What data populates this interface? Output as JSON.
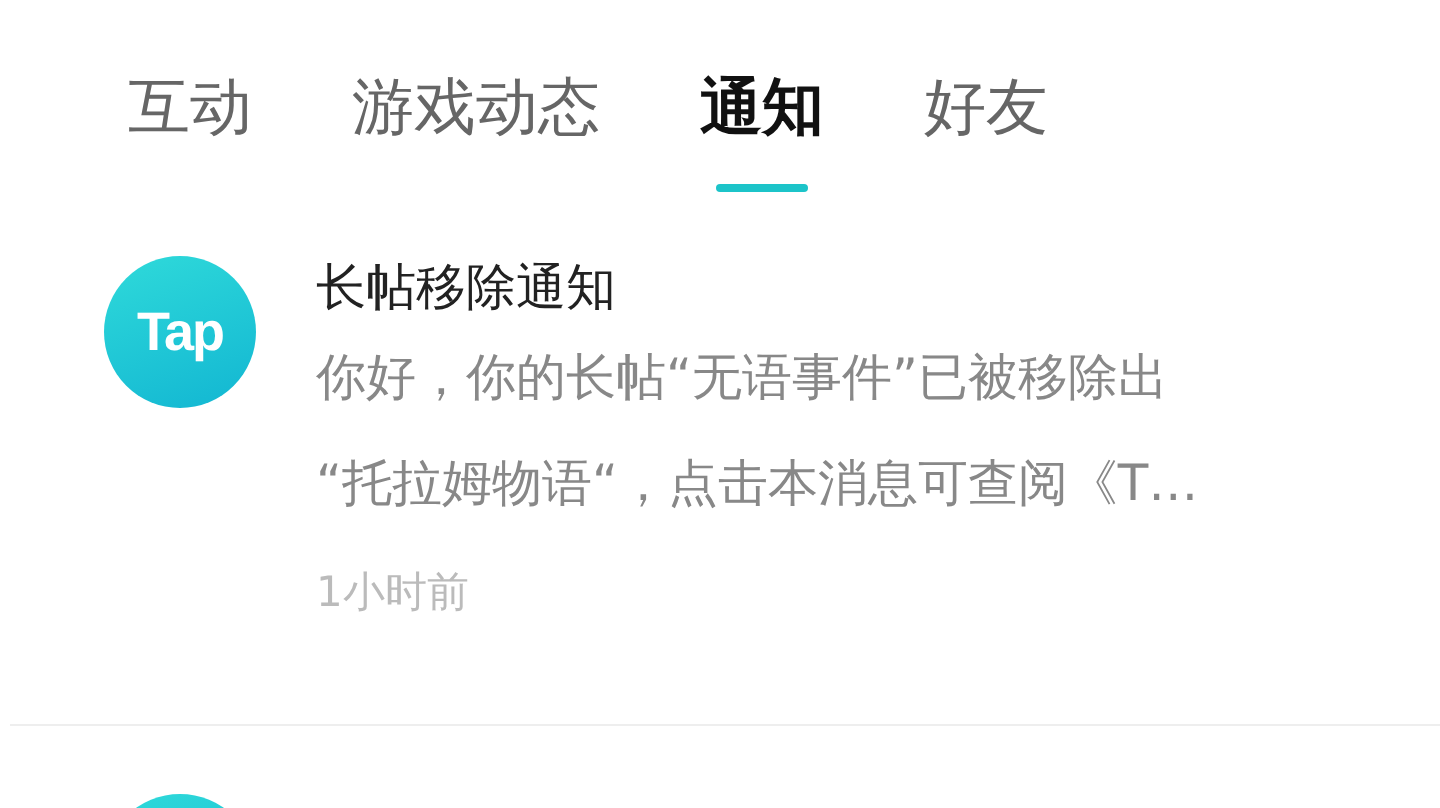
{
  "tabs": [
    {
      "label": "互动",
      "selected": false
    },
    {
      "label": "游戏动态",
      "selected": false
    },
    {
      "label": "通知",
      "selected": true
    },
    {
      "label": "好友",
      "selected": false
    }
  ],
  "notifications": [
    {
      "logo_text": "Tap",
      "title": "长帖移除通知",
      "body_lines": [
        "你好，你的长帖“无语事件”已被移除出",
        "“托拉姆物语“，点击本消息可查阅《T…"
      ],
      "time": "1小时前"
    },
    {
      "kind": "cut_off"
    }
  ]
}
